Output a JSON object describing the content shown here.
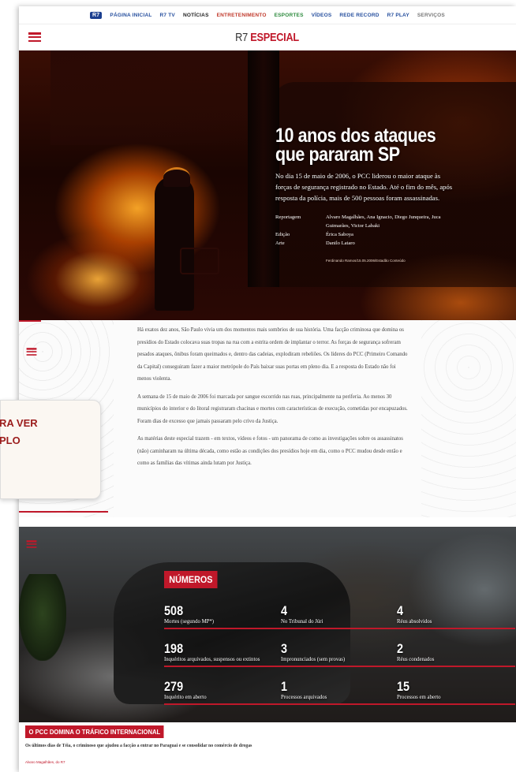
{
  "nav": {
    "items": [
      {
        "label": "PÁGINA INICIAL",
        "color": "blue"
      },
      {
        "label": "R7 TV",
        "color": "blue"
      },
      {
        "label": "NOTÍCIAS",
        "color": "black"
      },
      {
        "label": "ENTRETENIMENTO",
        "color": "red"
      },
      {
        "label": "ESPORTES",
        "color": "green"
      },
      {
        "label": "VÍDEOS",
        "color": "blue"
      },
      {
        "label": "REDE RECORD",
        "color": "blue"
      },
      {
        "label": "R7 PLAY",
        "color": "blue"
      },
      {
        "label": "SERVIÇOS",
        "color": "gray"
      }
    ],
    "logo": "R7"
  },
  "header": {
    "brand_prefix": "R7",
    "brand_suffix": "ESPECIAL",
    "menu_icon": "hamburger-icon"
  },
  "hero": {
    "title_line1": "10 anos dos ataques",
    "title_line2": "que pararam SP",
    "lead": "No dia 15 de maio de 2006, o PCC liderou o maior ataque às forças de segurança registrado no Estado. Até o fim do mês, após resposta da polícia, mais de 500 pessoas foram assassinadas.",
    "credits": [
      {
        "key": "Reportagem",
        "value": "Alvaro Magalhães, Ana Ignacio, Diego Junqueira, Juca Guimarães, Victor Labaki"
      },
      {
        "key": "Edição",
        "value": "Érica Saboya"
      },
      {
        "key": "Arte",
        "value": "Danilo Lataro"
      }
    ],
    "photo_credit": "Ferdinando Ramos/15.05.2006/Estadão Conteúdo"
  },
  "article": {
    "paragraphs": [
      "Há exatos dez anos, São Paulo vivia um dos momentos mais sombrios de sua história. Uma facção criminosa que domina os presídios do Estado colocava suas tropas na rua com a estrita ordem de implantar o terror. As forças de segurança sofreram pesados ataques, ônibus foram queimados e, dentro das cadeias, explodiram rebeliões. Os líderes do PCC (Primeiro Comando da Capital) conseguiram fazer a maior metrópole do País baixar suas portas em pleno dia. E a resposta do Estado não foi menos violenta.",
      "A semana de 15 de maio de 2006 foi marcada por sangue escorrido nas ruas, principalmente na periferia. Ao menos 30 municípios do interior e do litoral registraram chacinas e mortes com características de execução, cometidas por encapuzados. Foram dias de excesso que jamais passaram pelo crivo da Justiça.",
      "As matérias deste especial trazem - em textos, vídeos e fotos - um panorama de como as investigações sobre os assassinatos (não) caminharam na última década, como estão as condições dos presídios hoje em dia, como o PCC mudou desde então e como as famílias das vítimas ainda lutam por Justiça."
    ]
  },
  "popup": {
    "line1": "RA VER",
    "line2": "PLO"
  },
  "numbers": {
    "badge": "NÚMEROS",
    "stats": [
      {
        "num": "508",
        "label": "Mortes (segundo MP*)"
      },
      {
        "num": "4",
        "label": "No Tribunal do Júri"
      },
      {
        "num": "4",
        "label": "Réus absolvidos"
      },
      {
        "num": "198",
        "label": "Inquéritos arquivados, suspensos ou extintos"
      },
      {
        "num": "3",
        "label": "Impronunciados (sem provas)"
      },
      {
        "num": "2",
        "label": "Réus condenados"
      },
      {
        "num": "279",
        "label": "Inquérito em aberto"
      },
      {
        "num": "1",
        "label": "Processos arquivados"
      },
      {
        "num": "15",
        "label": "Processos em aberto"
      }
    ]
  },
  "teaser": {
    "tag": "O PCC DOMINA O TRÁFICO INTERNACIONAL",
    "subtitle": "Os últimos dias de Téia, o criminoso que ajudou a facção a entrar no Paraguai e se consolidar no comércio de drogas",
    "author": "Alvaro Magalhães, do R7"
  },
  "colors": {
    "accent": "#c0182a",
    "nav_blue": "#264f9e"
  }
}
